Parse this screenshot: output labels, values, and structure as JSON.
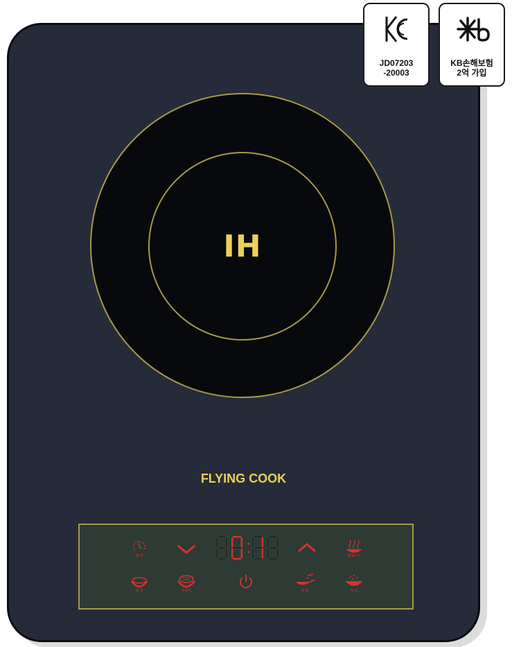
{
  "product": {
    "zone_label": "IH",
    "brand": "FLYING COOK"
  },
  "display": {
    "digits": [
      "8",
      "0",
      "1",
      "8"
    ],
    "lit": [
      false,
      true,
      true,
      false
    ]
  },
  "controls": {
    "row1": [
      {
        "icon": "timer-icon",
        "label": "예 약"
      },
      {
        "icon": "chevron-down-icon",
        "label": ""
      },
      {
        "icon": "chevron-up-icon",
        "label": ""
      },
      {
        "icon": "steam-icon",
        "label": "물끓이기"
      }
    ],
    "row2": [
      {
        "icon": "pot-icon",
        "label": "밥 짓"
      },
      {
        "icon": "pot-steam-icon",
        "label": "누룽지"
      },
      {
        "icon": "power-icon",
        "label": ""
      },
      {
        "icon": "pan-icon",
        "label": "볶 음"
      },
      {
        "icon": "wok-icon",
        "label": "튀 김"
      }
    ]
  },
  "badges": {
    "kc": {
      "text": "JD07203\n-20003"
    },
    "kb": {
      "text": "KB손해보험\n2억 가입"
    }
  },
  "colors": {
    "body": "#262b39",
    "accent_gold": "#ecd05a",
    "ring": "#a79a4a",
    "led_red": "#d8322e",
    "panel": "#2e3a34"
  }
}
